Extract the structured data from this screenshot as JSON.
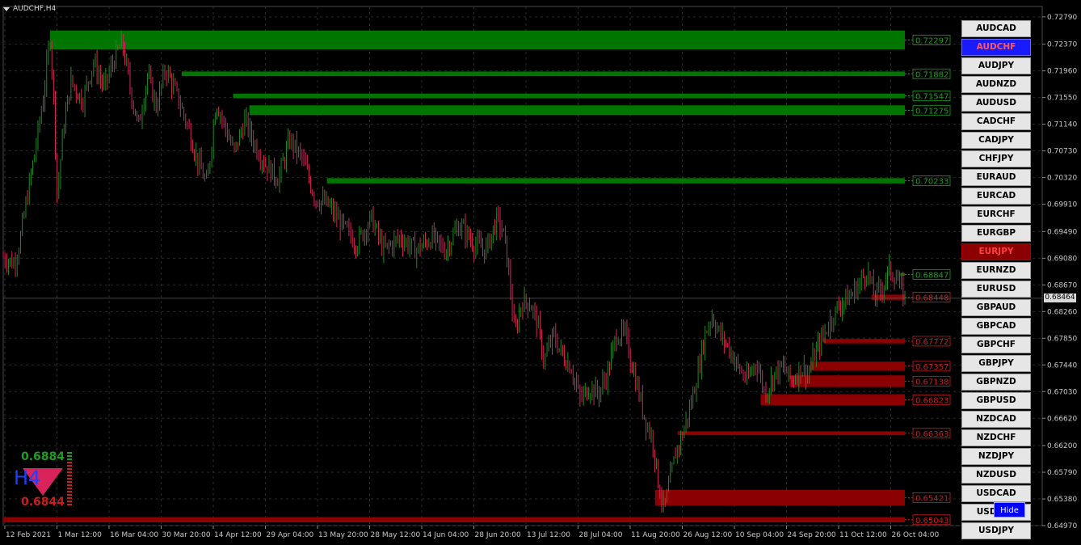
{
  "window": {
    "title": "AUDCHF,H4"
  },
  "colors": {
    "background": "#000000",
    "grid": "#2a2a2a",
    "axis_text": "#c8c8c8",
    "bull_candle": "#1e8c1e",
    "bear_candle": "#d8245a",
    "supply_zone": "#007500",
    "demand_zone": "#8b0000",
    "supply_label": "#1f9d1f",
    "demand_label": "#c81e1e",
    "active_symbol_bg": "#1a1aff",
    "alert_symbol_bg": "#8b0000",
    "hide_button_bg": "#0000ff"
  },
  "chart_data": {
    "type": "candlestick",
    "symbol": "AUDCHF",
    "timeframe": "H4",
    "y_range": [
      0.6497,
      0.7295
    ],
    "y_ticks": [
      "0.72790",
      "0.72370",
      "0.71960",
      "0.71550",
      "0.71140",
      "0.70730",
      "0.70320",
      "0.69910",
      "0.69490",
      "0.69080",
      "0.68670",
      "0.68260",
      "0.67850",
      "0.67440",
      "0.67030",
      "0.66620",
      "0.66200",
      "0.65790",
      "0.65380",
      "0.64970"
    ],
    "x_labels": [
      "12 Feb 2021",
      "1 Mar 12:00",
      "16 Mar 04:00",
      "30 Mar 20:00",
      "14 Apr 12:00",
      "29 Apr 04:00",
      "13 May 20:00",
      "28 May 12:00",
      "14 Jun 04:00",
      "28 Jun 20:00",
      "13 Jul 12:00",
      "28 Jul 04:00",
      "11 Aug 20:00",
      "26 Aug 12:00",
      "10 Sep 04:00",
      "24 Sep 20:00",
      "11 Oct 12:00",
      "26 Oct 04:00"
    ],
    "current_price": "0.68464",
    "price_path": [
      [
        0,
        0.691
      ],
      [
        0.012,
        0.69
      ],
      [
        0.018,
        0.693
      ],
      [
        0.025,
        0.699
      ],
      [
        0.035,
        0.707
      ],
      [
        0.045,
        0.716
      ],
      [
        0.052,
        0.725
      ],
      [
        0.056,
        0.715
      ],
      [
        0.06,
        0.7
      ],
      [
        0.066,
        0.71
      ],
      [
        0.075,
        0.718
      ],
      [
        0.088,
        0.715
      ],
      [
        0.1,
        0.721
      ],
      [
        0.112,
        0.717
      ],
      [
        0.122,
        0.721
      ],
      [
        0.132,
        0.724
      ],
      [
        0.142,
        0.716
      ],
      [
        0.15,
        0.711
      ],
      [
        0.16,
        0.719
      ],
      [
        0.17,
        0.714
      ],
      [
        0.18,
        0.72
      ],
      [
        0.192,
        0.716
      ],
      [
        0.205,
        0.711
      ],
      [
        0.215,
        0.706
      ],
      [
        0.226,
        0.702
      ],
      [
        0.236,
        0.715
      ],
      [
        0.246,
        0.711
      ],
      [
        0.256,
        0.707
      ],
      [
        0.268,
        0.712
      ],
      [
        0.28,
        0.708
      ],
      [
        0.292,
        0.705
      ],
      [
        0.305,
        0.703
      ],
      [
        0.318,
        0.709
      ],
      [
        0.332,
        0.706
      ],
      [
        0.346,
        0.7
      ],
      [
        0.36,
        0.699
      ],
      [
        0.375,
        0.696
      ],
      [
        0.392,
        0.693
      ],
      [
        0.408,
        0.697
      ],
      [
        0.422,
        0.692
      ],
      [
        0.44,
        0.694
      ],
      [
        0.458,
        0.692
      ],
      [
        0.475,
        0.694
      ],
      [
        0.49,
        0.692
      ],
      [
        0.506,
        0.696
      ],
      [
        0.522,
        0.693
      ],
      [
        0.535,
        0.692
      ],
      [
        0.548,
        0.697
      ],
      [
        0.556,
        0.694
      ],
      [
        0.562,
        0.687
      ],
      [
        0.567,
        0.679
      ],
      [
        0.575,
        0.684
      ],
      [
        0.584,
        0.684
      ],
      [
        0.592,
        0.681
      ],
      [
        0.6,
        0.675
      ],
      [
        0.61,
        0.679
      ],
      [
        0.62,
        0.676
      ],
      [
        0.63,
        0.674
      ],
      [
        0.64,
        0.669
      ],
      [
        0.65,
        0.671
      ],
      [
        0.66,
        0.67
      ],
      [
        0.67,
        0.673
      ],
      [
        0.68,
        0.679
      ],
      [
        0.69,
        0.679
      ],
      [
        0.698,
        0.674
      ],
      [
        0.705,
        0.67
      ],
      [
        0.712,
        0.666
      ],
      [
        0.72,
        0.663
      ],
      [
        0.727,
        0.656
      ],
      [
        0.733,
        0.652
      ],
      [
        0.74,
        0.657
      ],
      [
        0.746,
        0.661
      ],
      [
        0.754,
        0.664
      ],
      [
        0.762,
        0.668
      ],
      [
        0.77,
        0.673
      ],
      [
        0.778,
        0.679
      ],
      [
        0.786,
        0.682
      ],
      [
        0.795,
        0.679
      ],
      [
        0.805,
        0.677
      ],
      [
        0.815,
        0.674
      ],
      [
        0.825,
        0.672
      ],
      [
        0.835,
        0.675
      ],
      [
        0.845,
        0.67
      ],
      [
        0.855,
        0.673
      ],
      [
        0.865,
        0.674
      ],
      [
        0.875,
        0.672
      ],
      [
        0.885,
        0.674
      ],
      [
        0.893,
        0.673
      ],
      [
        0.9,
        0.676
      ],
      [
        0.91,
        0.679
      ],
      [
        0.92,
        0.682
      ],
      [
        0.93,
        0.684
      ],
      [
        0.94,
        0.685
      ],
      [
        0.95,
        0.687
      ],
      [
        0.958,
        0.689
      ],
      [
        0.966,
        0.685
      ],
      [
        0.974,
        0.686
      ],
      [
        0.982,
        0.689
      ],
      [
        0.99,
        0.688
      ],
      [
        1.0,
        0.6846
      ]
    ],
    "supply_zones": [
      {
        "label": "0.72297",
        "top": 0.7258,
        "bottom": 0.7229,
        "start": 0.052
      },
      {
        "label": "0.71882",
        "top": 0.7195,
        "bottom": 0.7188,
        "start": 0.198
      },
      {
        "label": "0.71547",
        "top": 0.7161,
        "bottom": 0.7154,
        "start": 0.255
      },
      {
        "label": "0.71275",
        "top": 0.7143,
        "bottom": 0.7128,
        "start": 0.273
      },
      {
        "label": "0.70233",
        "top": 0.7031,
        "bottom": 0.7023,
        "start": 0.359
      },
      {
        "label": "0.68847",
        "top": 0.6885,
        "bottom": 0.6885,
        "start": 0.995
      }
    ],
    "demand_zones": [
      {
        "label": "0.68448",
        "top": 0.6852,
        "bottom": 0.6844,
        "start": 0.963
      },
      {
        "label": "0.67772",
        "top": 0.6784,
        "bottom": 0.6777,
        "start": 0.91
      },
      {
        "label": "0.67357",
        "top": 0.6749,
        "bottom": 0.6735,
        "start": 0.895
      },
      {
        "label": "0.67138",
        "top": 0.6728,
        "bottom": 0.671,
        "start": 0.872
      },
      {
        "label": "0.66823",
        "top": 0.6699,
        "bottom": 0.6682,
        "start": 0.84
      },
      {
        "label": "0.66363",
        "top": 0.6642,
        "bottom": 0.6636,
        "start": 0.748
      },
      {
        "label": "0.65421",
        "top": 0.6552,
        "bottom": 0.6528,
        "start": 0.723
      },
      {
        "label": "0.65043",
        "top": 0.651,
        "bottom": 0.6502,
        "start": 0.0
      }
    ]
  },
  "widget": {
    "high": "0.6884",
    "low": "0.6844",
    "timeframe": "H4"
  },
  "symbols": [
    {
      "label": "AUDCAD",
      "state": "normal"
    },
    {
      "label": "AUDCHF",
      "state": "active"
    },
    {
      "label": "AUDJPY",
      "state": "normal"
    },
    {
      "label": "AUDNZD",
      "state": "normal"
    },
    {
      "label": "AUDUSD",
      "state": "normal"
    },
    {
      "label": "CADCHF",
      "state": "normal"
    },
    {
      "label": "CADJPY",
      "state": "normal"
    },
    {
      "label": "CHFJPY",
      "state": "normal"
    },
    {
      "label": "EURAUD",
      "state": "normal"
    },
    {
      "label": "EURCAD",
      "state": "normal"
    },
    {
      "label": "EURCHF",
      "state": "normal"
    },
    {
      "label": "EURGBP",
      "state": "normal"
    },
    {
      "label": "EURJPY",
      "state": "alert"
    },
    {
      "label": "EURNZD",
      "state": "normal"
    },
    {
      "label": "EURUSD",
      "state": "normal"
    },
    {
      "label": "GBPAUD",
      "state": "normal"
    },
    {
      "label": "GBPCAD",
      "state": "normal"
    },
    {
      "label": "GBPCHF",
      "state": "normal"
    },
    {
      "label": "GBPJPY",
      "state": "normal"
    },
    {
      "label": "GBPNZD",
      "state": "normal"
    },
    {
      "label": "GBPUSD",
      "state": "normal"
    },
    {
      "label": "NZDCAD",
      "state": "normal"
    },
    {
      "label": "NZDCHF",
      "state": "normal"
    },
    {
      "label": "NZDJPY",
      "state": "normal"
    },
    {
      "label": "NZDUSD",
      "state": "normal"
    },
    {
      "label": "USDCAD",
      "state": "normal"
    },
    {
      "label": "USDCHF",
      "state": "normal"
    },
    {
      "label": "USDJPY",
      "state": "normal"
    }
  ],
  "hide_button": {
    "label": "Hide"
  }
}
